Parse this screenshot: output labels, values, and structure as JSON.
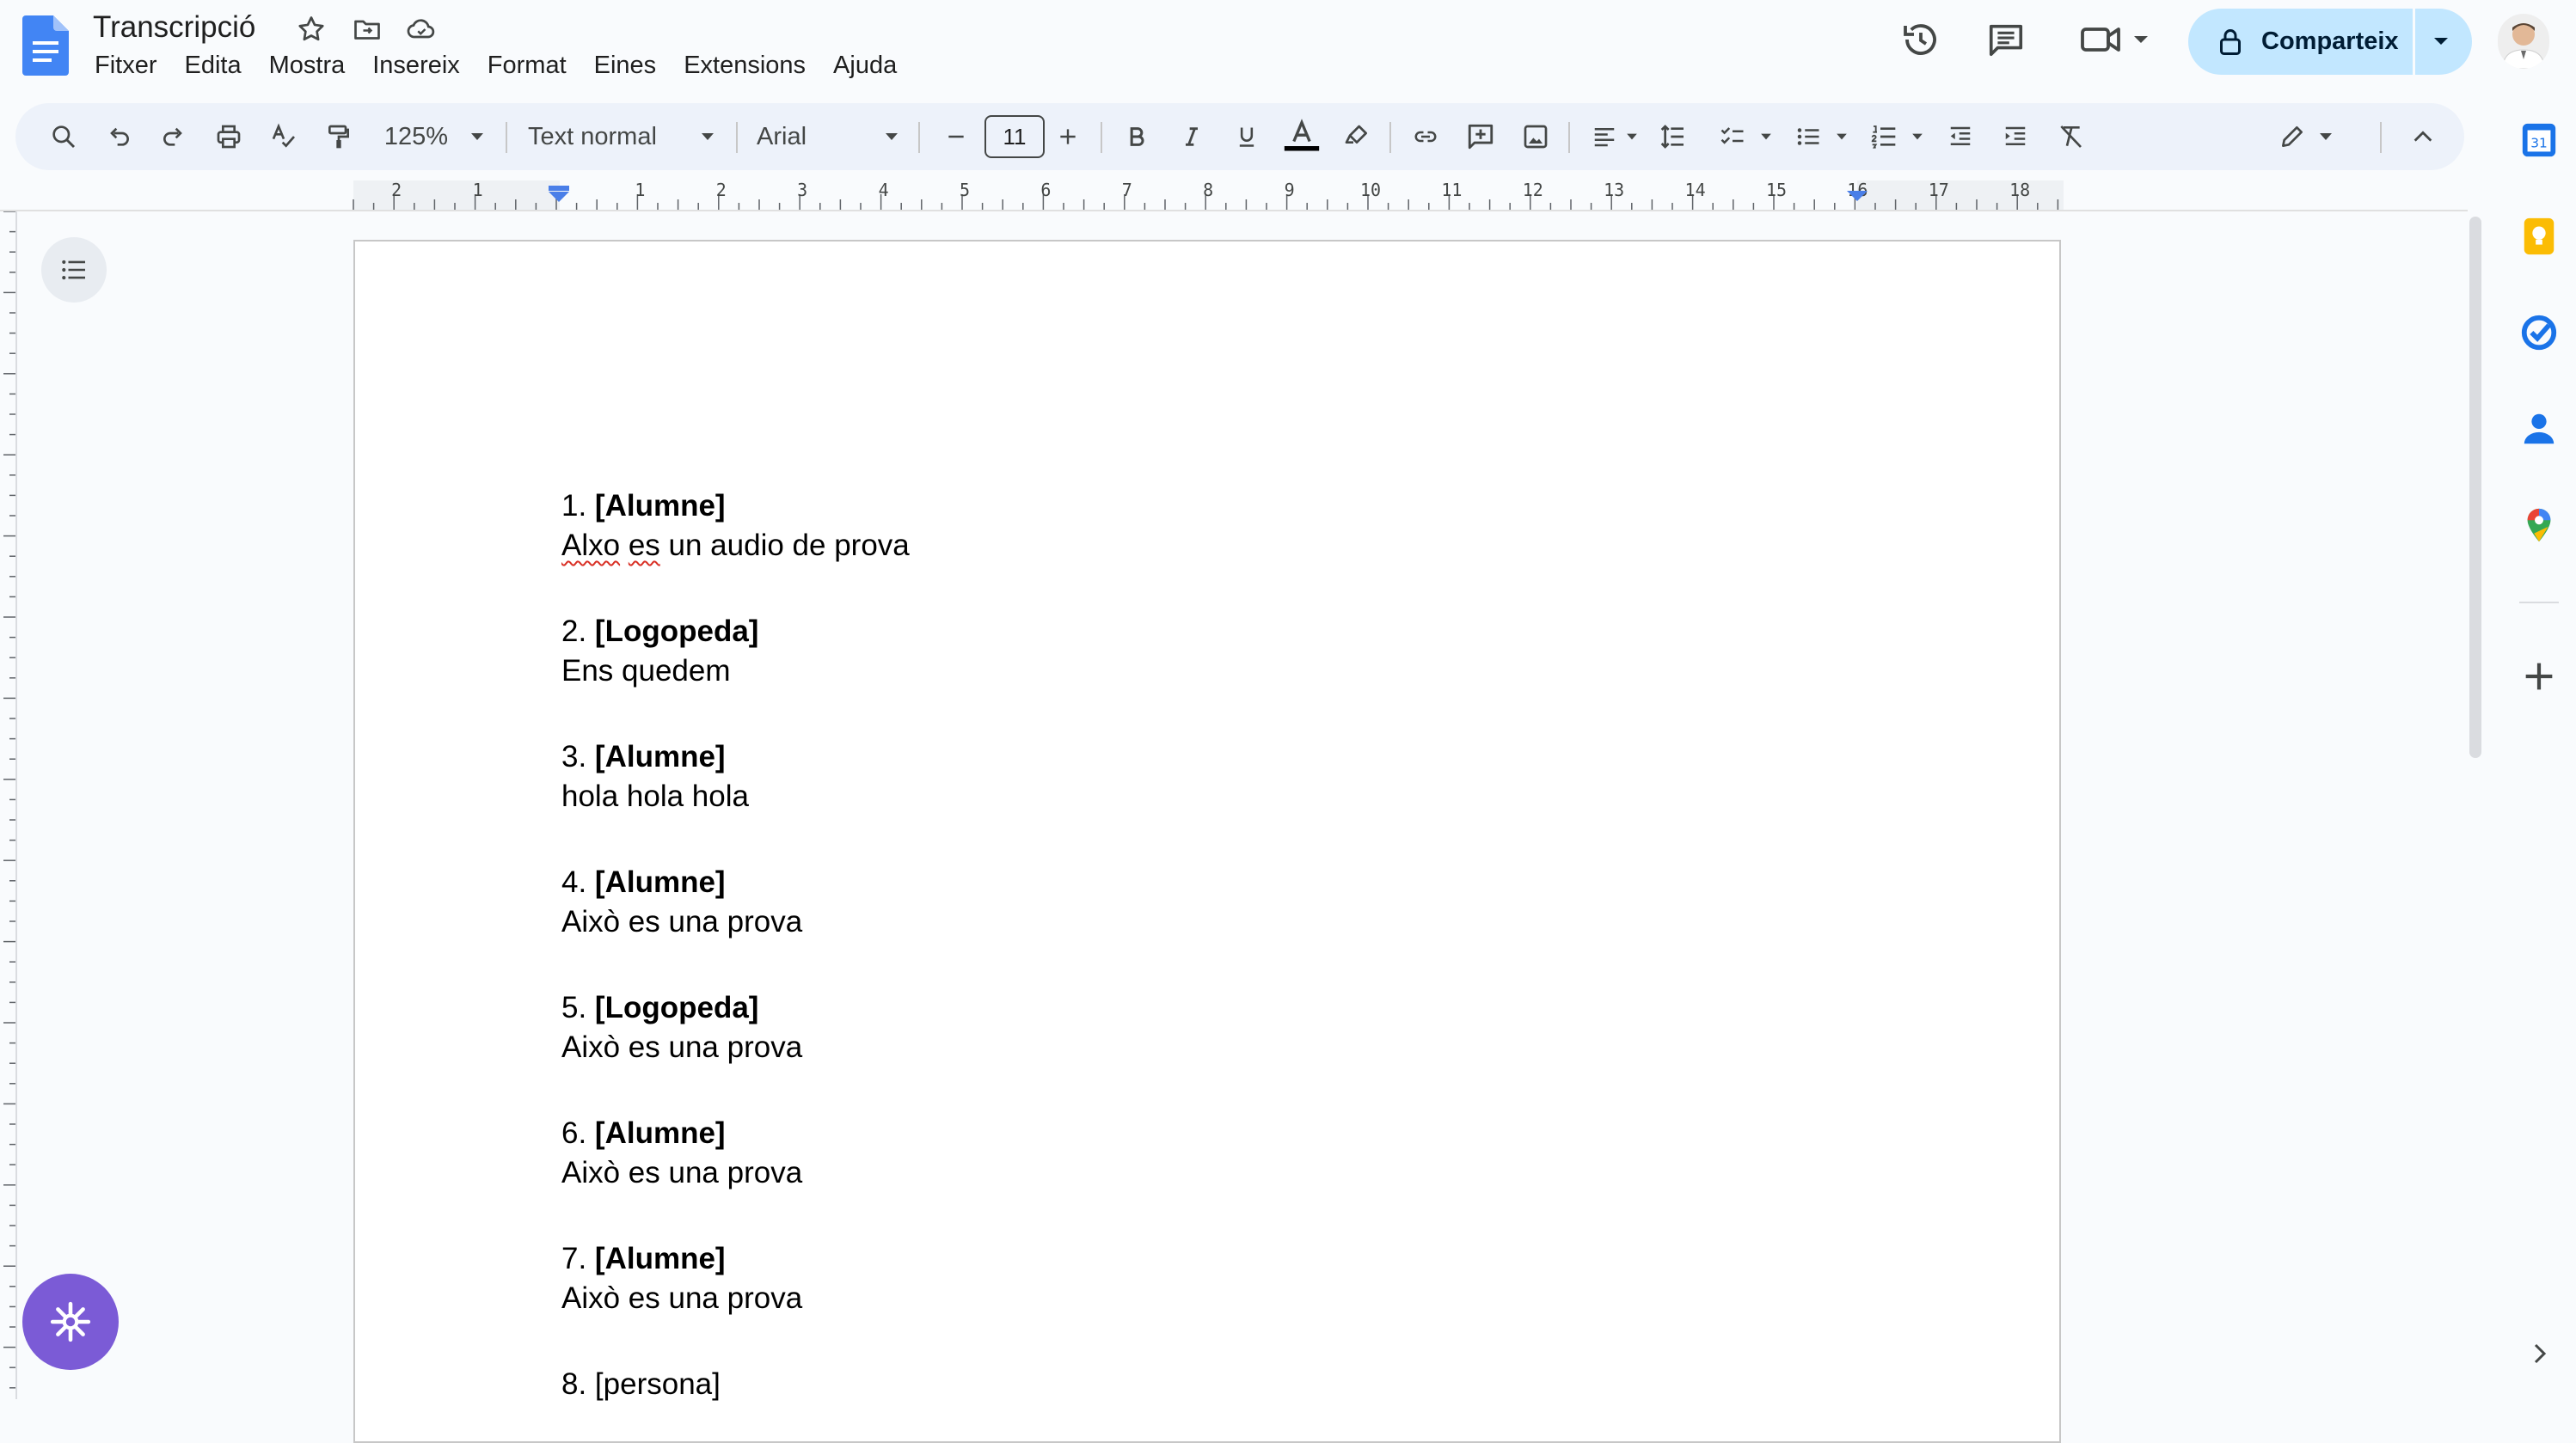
{
  "header": {
    "title": "Transcripció",
    "menu": [
      "Fitxer",
      "Edita",
      "Mostra",
      "Insereix",
      "Format",
      "Eines",
      "Extensions",
      "Ajuda"
    ],
    "share_label": "Comparteix",
    "icons": [
      "docs-logo-icon",
      "star-icon",
      "move-folder-icon",
      "cloud-saved-icon",
      "history-icon",
      "comments-icon",
      "meet-icon",
      "lock-icon",
      "avatar"
    ]
  },
  "toolbar": {
    "zoom": "125%",
    "style": "Text normal",
    "font": "Arial",
    "font_size": "11"
  },
  "ruler": {
    "labels": [
      "2",
      "1",
      "1",
      "2",
      "3",
      "4",
      "5",
      "6",
      "7",
      "8",
      "9",
      "10",
      "11",
      "12",
      "13",
      "14",
      "15",
      "16",
      "17",
      "18"
    ]
  },
  "document": {
    "entries": [
      {
        "num": "1.",
        "speaker": "[Alumne]",
        "bold": true,
        "text_parts": [
          {
            "t": "Alxo",
            "spell": true
          },
          {
            "t": " ",
            "spell": false
          },
          {
            "t": "es",
            "spell": true
          },
          {
            "t": " un audio de prova",
            "spell": false
          }
        ]
      },
      {
        "num": "2.",
        "speaker": "[Logopeda]",
        "bold": true,
        "text_parts": [
          {
            "t": "Ens quedem",
            "spell": false
          }
        ]
      },
      {
        "num": "3.",
        "speaker": "[Alumne]",
        "bold": true,
        "text_parts": [
          {
            "t": "hola hola hola",
            "spell": false
          }
        ]
      },
      {
        "num": "4.",
        "speaker": "[Alumne]",
        "bold": true,
        "text_parts": [
          {
            "t": "Això es una prova",
            "spell": false
          }
        ]
      },
      {
        "num": "5.",
        "speaker": "[Logopeda]",
        "bold": true,
        "text_parts": [
          {
            "t": "Això es una prova",
            "spell": false
          }
        ]
      },
      {
        "num": "6.",
        "speaker": "[Alumne]",
        "bold": true,
        "text_parts": [
          {
            "t": "Això es una prova",
            "spell": false
          }
        ]
      },
      {
        "num": "7.",
        "speaker": "[Alumne]",
        "bold": true,
        "text_parts": [
          {
            "t": "Això es una prova",
            "spell": false
          }
        ]
      },
      {
        "num": "8.",
        "speaker": "[persona]",
        "bold": false,
        "text_parts": []
      }
    ]
  },
  "colors": {
    "share_bg": "#c2e7ff",
    "toolbar_bg": "#edf2fa",
    "fab": "#7b5bd6",
    "spell": "#d93025"
  }
}
